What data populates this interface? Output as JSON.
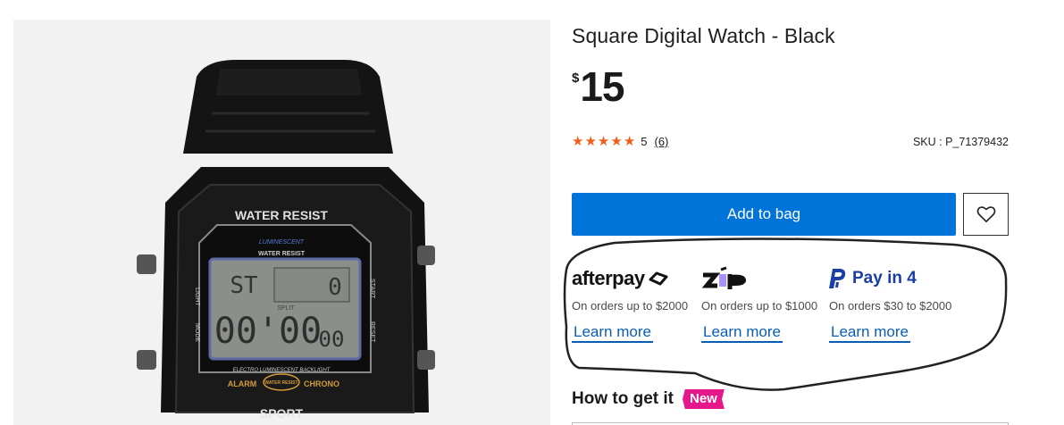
{
  "product": {
    "title": "Square Digital Watch - Black",
    "currency_symbol": "$",
    "price": "15",
    "rating_value": "5",
    "rating_count": "(6)",
    "stars": 5,
    "sku": "SKU : P_71379432"
  },
  "image": {
    "watch_label_top": "WATER RESIST",
    "luminescent": "LUMINESCENT",
    "water_resist_small": "WATER RESIST",
    "lcd_mode": "ST",
    "lcd_small": "0",
    "lcd_split": "SPLIT",
    "lcd_main": "00'00",
    "lcd_sec": "00",
    "side_light": "LIGHT",
    "side_mode": "MODE",
    "side_start": "START",
    "side_reset": "RESET",
    "backlight": "ELECTRO LUMINESCENT BACKLIGHT",
    "alarm": "ALARM",
    "chrono": "CHRONO",
    "badge_wr": "WATER RESIST",
    "bottom_label": "SPORT"
  },
  "actions": {
    "add_to_bag": "Add to bag",
    "wishlist_icon": "heart-icon"
  },
  "payments": [
    {
      "name": "afterpay",
      "logo_text": "afterpay",
      "desc": "On orders up to $2000",
      "learn": "Learn more"
    },
    {
      "name": "zip",
      "logo_text": "zip",
      "desc": "On orders up to $1000",
      "learn": "Learn more"
    },
    {
      "name": "paypal",
      "logo_text": "Pay in 4",
      "desc": "On orders $30 to $2000",
      "learn": "Learn more"
    }
  ],
  "delivery": {
    "heading": "How to get it",
    "badge": "New"
  },
  "colors": {
    "accent_blue": "#0074d9",
    "star_orange": "#f25d1a",
    "badge_pink": "#e6178a",
    "link_blue": "#0a5db5",
    "zip_purple": "#aa8fff",
    "paypal_blue": "#1a3ea6"
  }
}
